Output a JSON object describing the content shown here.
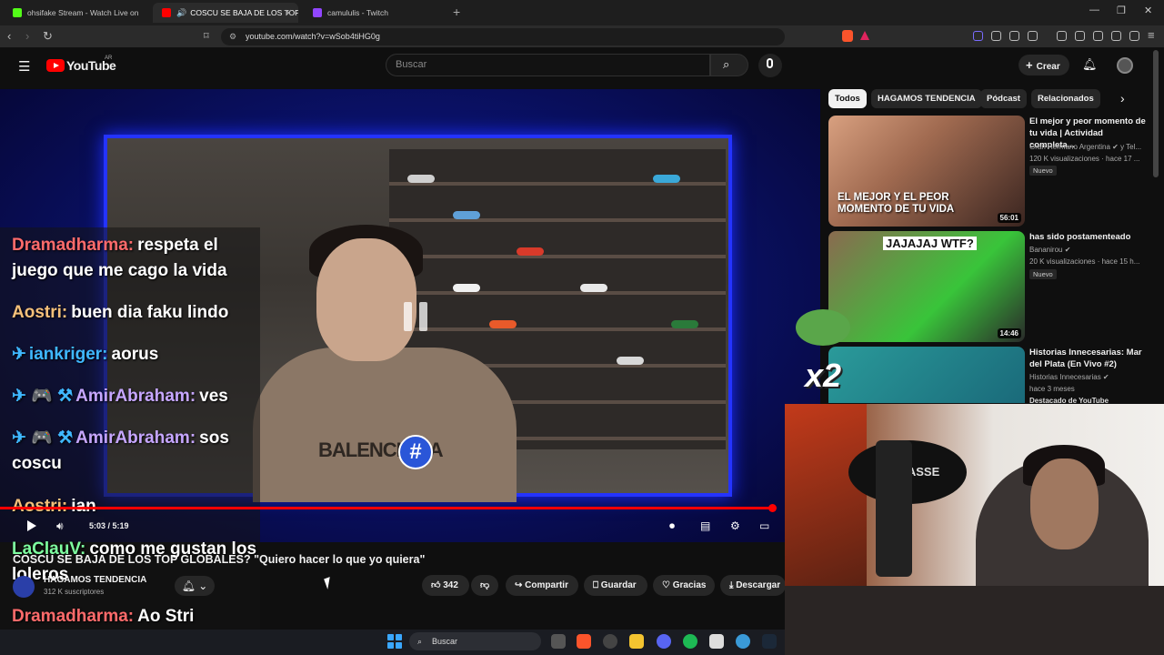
{
  "browser": {
    "tabs": [
      {
        "title": "ohsifake Stream - Watch Live on",
        "favicon_color": "#53fc18",
        "active": false
      },
      {
        "title": "COSCU SE BAJA DE LOS TOP",
        "favicon_color": "#ff0000",
        "active": true
      },
      {
        "title": "camululis - Twitch",
        "favicon_color": "#9146ff",
        "active": false
      }
    ],
    "url": "youtube.com/watch?v=wSob4tiHG0g"
  },
  "youtube": {
    "logo": "YouTube",
    "region": "AR",
    "search_placeholder": "Buscar",
    "create_label": "Crear"
  },
  "player": {
    "shirt_text": "BALENCIAGA",
    "badge": "#",
    "time": "5:03 / 5:19",
    "progress": 0.95
  },
  "chat": [
    {
      "user": "Dramadharma:",
      "color": "#ff6b6b",
      "icons": "",
      "text": "respeta el juego que me cago la vida"
    },
    {
      "user": "Aostri:",
      "color": "#f5c07a",
      "icons": "",
      "text": "buen dia faku lindo"
    },
    {
      "user": "iankriger:",
      "color": "#3fb8ff",
      "icons": "✈",
      "text": "aorus"
    },
    {
      "user": "AmirAbraham:",
      "color": "#c6a6ff",
      "icons": "✈ 🎮 ⚒",
      "text": "ves"
    },
    {
      "user": "AmirAbraham:",
      "color": "#c6a6ff",
      "icons": "✈ 🎮 ⚒",
      "text": "sos coscu"
    },
    {
      "user": "Aostri:",
      "color": "#f5c07a",
      "icons": "",
      "text": "ian"
    },
    {
      "user": "LaClauV:",
      "color": "#7effa0",
      "icons": "",
      "text": "como me gustan los loleros"
    },
    {
      "user": "Dramadharma:",
      "color": "#ff6b6b",
      "icons": "",
      "text": "Ao Stri"
    }
  ],
  "video": {
    "title": "COSCU SE BAJA DE LOS TOP GLOBALES? \"Quiero hacer lo que yo quiera\"",
    "channel": "HAGAMOS TENDENCIA",
    "subscribers": "312 K suscriptores",
    "likes": "342",
    "share_label": "Compartir",
    "save_label": "Guardar",
    "thanks_label": "Gracias",
    "download_label": "Descargar"
  },
  "chips": [
    "Todos",
    "HAGAMOS TENDENCIA",
    "Pódcast",
    "Relacionados"
  ],
  "recommendations": [
    {
      "thumb_text": "EL MEJOR Y EL PEOR MOMENTO DE TU VIDA",
      "duration": "56:01",
      "title": "El mejor y peor momento de tu vida | Actividad completa...",
      "channel": "Gran Hermano Argentina ✔ y Tel...",
      "meta": "120 K visualizaciones · hace 17 ...",
      "badge": "Nuevo"
    },
    {
      "thumb_text": "JAJAJAJ WTF?",
      "duration": "14:46",
      "title": "has sido postamenteado",
      "channel": "Bananirou ✔",
      "meta": "20 K visualizaciones · hace 15 h...",
      "badge": "Nuevo"
    },
    {
      "thumb_text": "",
      "duration": "",
      "title": "Historias Innecesarias: Mar del Plata (En Vivo #2)",
      "channel": "Historias Innecesarias ✔",
      "meta": "hace 3 meses",
      "badge": "Destacado de YouTube"
    }
  ],
  "webcam": {
    "sign_text": "CREPASSE"
  },
  "emote": {
    "multiplier": "x2"
  },
  "taskbar": {
    "search_placeholder": "Buscar"
  }
}
